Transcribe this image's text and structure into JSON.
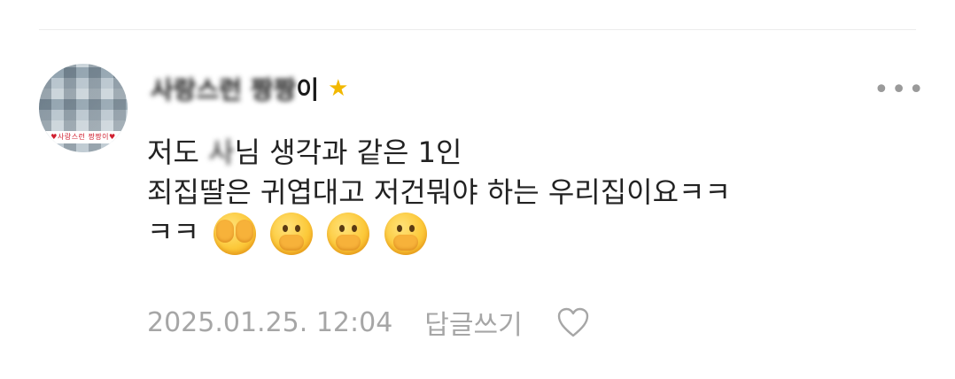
{
  "comment": {
    "author": {
      "nickname_visible_end": "이",
      "badge_icon": "star-icon",
      "badge_color": "#f2b800",
      "avatar_caption": "♥사랑스런 짱짱이♥"
    },
    "body": {
      "line1_prefix": "저도 ",
      "line1_masked": "사",
      "line1_suffix": "님 생각과 같은 1인",
      "line2": "죄집딸은 귀엽대고 저건뭐야 하는 우리집이요ㅋㅋ",
      "line3_text": "ㅋㅋ",
      "emojis": [
        "face-with-hand-over-eyes",
        "face-with-hand-over-mouth",
        "face-with-hand-over-mouth",
        "face-with-hand-over-mouth"
      ]
    },
    "date": "2025.01.25. 12:04",
    "reply_label": "답글쓰기",
    "like_icon": "heart-outline-icon",
    "more_icon": "more-horizontal-icon",
    "more_glyph": "•••"
  }
}
